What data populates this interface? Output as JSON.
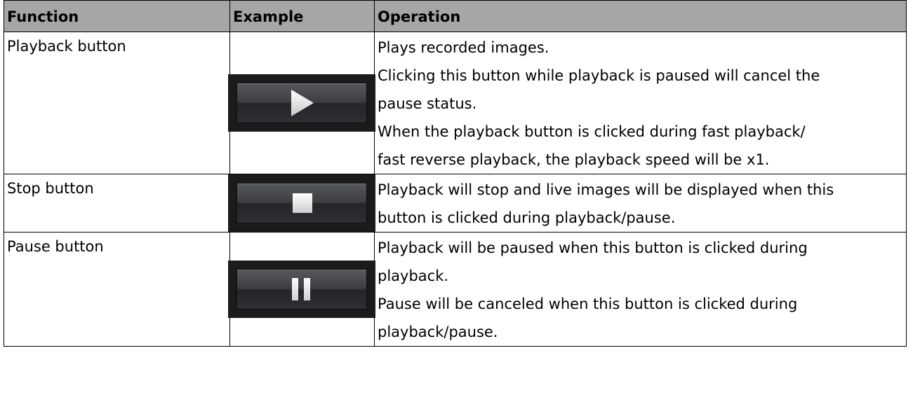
{
  "table": {
    "headers": {
      "function": "Function",
      "example": "Example",
      "operation": "Operation"
    },
    "rows": [
      {
        "function": "Playback button",
        "example_icon": "play-icon",
        "operation_lines": [
          "Plays recorded images.",
          "Clicking this button while playback is paused will cancel the",
          "pause status.",
          "When the playback button is clicked during fast playback/",
          "fast reverse playback, the playback speed will be x1."
        ]
      },
      {
        "function": "Stop button",
        "example_icon": "stop-icon",
        "operation_lines": [
          "Playback will stop and live images will be displayed when this",
          "button is clicked during playback/pause."
        ]
      },
      {
        "function": "Pause button",
        "example_icon": "pause-icon",
        "operation_lines": [
          "Playback will be paused when this button is clicked during",
          "playback.",
          "Pause will be canceled when this button is clicked during",
          "playback/pause."
        ]
      }
    ]
  }
}
